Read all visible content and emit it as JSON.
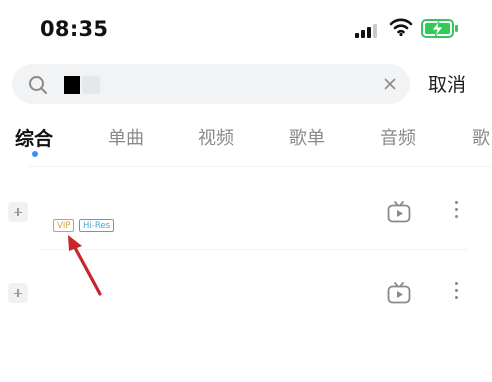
{
  "status_bar": {
    "time": "08:35",
    "battery_color": "#34c759",
    "icons": [
      "cellular-signal-icon",
      "wifi-icon",
      "battery-charging-icon"
    ]
  },
  "search": {
    "query_value": "",
    "placeholder": "",
    "clear_icon": "close-icon",
    "cancel_label": "取消"
  },
  "tabs": {
    "items": [
      {
        "label": "综合",
        "active": true
      },
      {
        "label": "单曲",
        "active": false
      },
      {
        "label": "视频",
        "active": false
      },
      {
        "label": "歌单",
        "active": false
      },
      {
        "label": "音频",
        "active": false
      },
      {
        "label": "歌",
        "active": false
      }
    ],
    "indicator_color": "#3b8df0"
  },
  "results": [
    {
      "badges": [
        "VIP",
        "Hi-Res"
      ],
      "actions": [
        "add-icon",
        "mv-icon",
        "more-icon"
      ]
    },
    {
      "badges": [],
      "actions": [
        "add-icon",
        "mv-icon",
        "more-icon"
      ]
    }
  ],
  "colors": {
    "vip": "#d4a23a",
    "hires": "#4aa3d8",
    "annotation_arrow": "#c8262c"
  }
}
